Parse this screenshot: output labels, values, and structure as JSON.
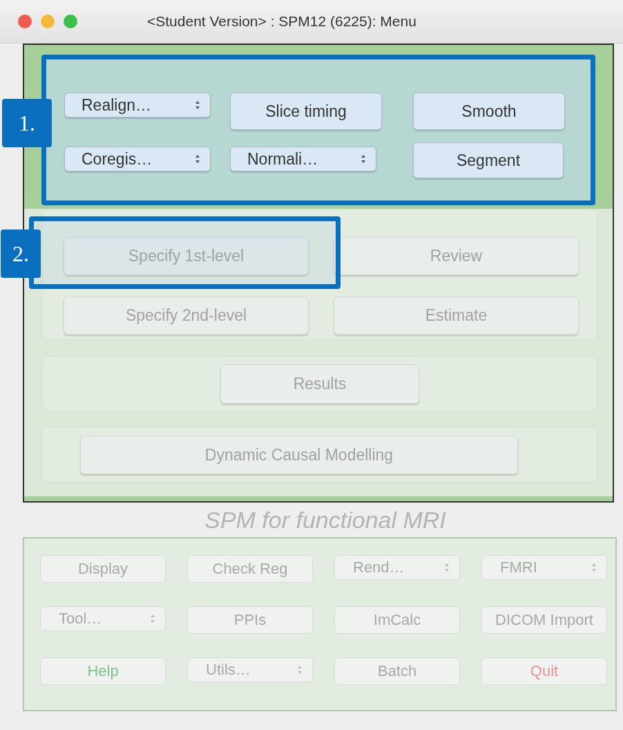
{
  "window": {
    "title": "<Student Version> : SPM12 (6225): Menu"
  },
  "preprocessing": {
    "callout": "1.",
    "buttons": [
      {
        "label": "Realign…",
        "kind": "popup"
      },
      {
        "label": "Slice timing",
        "kind": "button"
      },
      {
        "label": "Smooth",
        "kind": "button"
      },
      {
        "label": "Coregis…",
        "kind": "popup"
      },
      {
        "label": "Normali…",
        "kind": "popup"
      },
      {
        "label": "Segment",
        "kind": "button"
      }
    ]
  },
  "model": {
    "buttons": [
      {
        "label": "Specify 1st-level",
        "callout": "2."
      },
      {
        "label": "Review"
      },
      {
        "label": "Specify 2nd-level"
      },
      {
        "label": "Estimate"
      }
    ]
  },
  "results": {
    "label": "Results"
  },
  "dcm": {
    "label": "Dynamic Causal Modelling"
  },
  "subtitle": "SPM for functional MRI",
  "utilities": {
    "buttons": [
      {
        "label": "Display",
        "kind": "button"
      },
      {
        "label": "Check Reg",
        "kind": "button"
      },
      {
        "label": "Rend…",
        "kind": "popup"
      },
      {
        "label": "FMRI",
        "kind": "popup"
      },
      {
        "label": "Tool…",
        "kind": "popup"
      },
      {
        "label": "PPIs",
        "kind": "button"
      },
      {
        "label": "ImCalc",
        "kind": "button"
      },
      {
        "label": "DICOM Import",
        "kind": "button"
      },
      {
        "label": "Help",
        "kind": "button",
        "color": "#7fbf8a"
      },
      {
        "label": "Utils…",
        "kind": "popup"
      },
      {
        "label": "Batch",
        "kind": "button"
      },
      {
        "label": "Quit",
        "kind": "button",
        "color": "#e89090"
      }
    ]
  }
}
